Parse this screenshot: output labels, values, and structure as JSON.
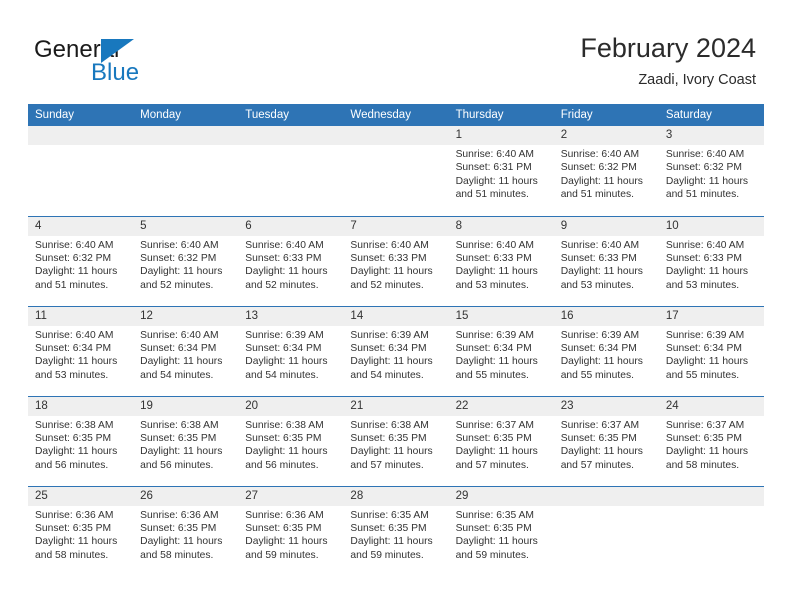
{
  "logo": {
    "word1": "General",
    "word2": "Blue",
    "accent_color": "#1878be",
    "triangle_icon": "triangle-icon"
  },
  "header": {
    "title": "February 2024",
    "subtitle": "Zaadi, Ivory Coast"
  },
  "theme": {
    "header_blue": "#2e74b5",
    "daynum_band": "#efefef",
    "text": "#333333"
  },
  "calendar": {
    "columns": [
      "Sunday",
      "Monday",
      "Tuesday",
      "Wednesday",
      "Thursday",
      "Friday",
      "Saturday"
    ],
    "weeks": [
      [
        {
          "day": ""
        },
        {
          "day": ""
        },
        {
          "day": ""
        },
        {
          "day": ""
        },
        {
          "day": "1",
          "sunrise": "Sunrise: 6:40 AM",
          "sunset": "Sunset: 6:31 PM",
          "daylight_line1": "Daylight: 11 hours",
          "daylight_line2": "and 51 minutes."
        },
        {
          "day": "2",
          "sunrise": "Sunrise: 6:40 AM",
          "sunset": "Sunset: 6:32 PM",
          "daylight_line1": "Daylight: 11 hours",
          "daylight_line2": "and 51 minutes."
        },
        {
          "day": "3",
          "sunrise": "Sunrise: 6:40 AM",
          "sunset": "Sunset: 6:32 PM",
          "daylight_line1": "Daylight: 11 hours",
          "daylight_line2": "and 51 minutes."
        }
      ],
      [
        {
          "day": "4",
          "sunrise": "Sunrise: 6:40 AM",
          "sunset": "Sunset: 6:32 PM",
          "daylight_line1": "Daylight: 11 hours",
          "daylight_line2": "and 51 minutes."
        },
        {
          "day": "5",
          "sunrise": "Sunrise: 6:40 AM",
          "sunset": "Sunset: 6:32 PM",
          "daylight_line1": "Daylight: 11 hours",
          "daylight_line2": "and 52 minutes."
        },
        {
          "day": "6",
          "sunrise": "Sunrise: 6:40 AM",
          "sunset": "Sunset: 6:33 PM",
          "daylight_line1": "Daylight: 11 hours",
          "daylight_line2": "and 52 minutes."
        },
        {
          "day": "7",
          "sunrise": "Sunrise: 6:40 AM",
          "sunset": "Sunset: 6:33 PM",
          "daylight_line1": "Daylight: 11 hours",
          "daylight_line2": "and 52 minutes."
        },
        {
          "day": "8",
          "sunrise": "Sunrise: 6:40 AM",
          "sunset": "Sunset: 6:33 PM",
          "daylight_line1": "Daylight: 11 hours",
          "daylight_line2": "and 53 minutes."
        },
        {
          "day": "9",
          "sunrise": "Sunrise: 6:40 AM",
          "sunset": "Sunset: 6:33 PM",
          "daylight_line1": "Daylight: 11 hours",
          "daylight_line2": "and 53 minutes."
        },
        {
          "day": "10",
          "sunrise": "Sunrise: 6:40 AM",
          "sunset": "Sunset: 6:33 PM",
          "daylight_line1": "Daylight: 11 hours",
          "daylight_line2": "and 53 minutes."
        }
      ],
      [
        {
          "day": "11",
          "sunrise": "Sunrise: 6:40 AM",
          "sunset": "Sunset: 6:34 PM",
          "daylight_line1": "Daylight: 11 hours",
          "daylight_line2": "and 53 minutes."
        },
        {
          "day": "12",
          "sunrise": "Sunrise: 6:40 AM",
          "sunset": "Sunset: 6:34 PM",
          "daylight_line1": "Daylight: 11 hours",
          "daylight_line2": "and 54 minutes."
        },
        {
          "day": "13",
          "sunrise": "Sunrise: 6:39 AM",
          "sunset": "Sunset: 6:34 PM",
          "daylight_line1": "Daylight: 11 hours",
          "daylight_line2": "and 54 minutes."
        },
        {
          "day": "14",
          "sunrise": "Sunrise: 6:39 AM",
          "sunset": "Sunset: 6:34 PM",
          "daylight_line1": "Daylight: 11 hours",
          "daylight_line2": "and 54 minutes."
        },
        {
          "day": "15",
          "sunrise": "Sunrise: 6:39 AM",
          "sunset": "Sunset: 6:34 PM",
          "daylight_line1": "Daylight: 11 hours",
          "daylight_line2": "and 55 minutes."
        },
        {
          "day": "16",
          "sunrise": "Sunrise: 6:39 AM",
          "sunset": "Sunset: 6:34 PM",
          "daylight_line1": "Daylight: 11 hours",
          "daylight_line2": "and 55 minutes."
        },
        {
          "day": "17",
          "sunrise": "Sunrise: 6:39 AM",
          "sunset": "Sunset: 6:34 PM",
          "daylight_line1": "Daylight: 11 hours",
          "daylight_line2": "and 55 minutes."
        }
      ],
      [
        {
          "day": "18",
          "sunrise": "Sunrise: 6:38 AM",
          "sunset": "Sunset: 6:35 PM",
          "daylight_line1": "Daylight: 11 hours",
          "daylight_line2": "and 56 minutes."
        },
        {
          "day": "19",
          "sunrise": "Sunrise: 6:38 AM",
          "sunset": "Sunset: 6:35 PM",
          "daylight_line1": "Daylight: 11 hours",
          "daylight_line2": "and 56 minutes."
        },
        {
          "day": "20",
          "sunrise": "Sunrise: 6:38 AM",
          "sunset": "Sunset: 6:35 PM",
          "daylight_line1": "Daylight: 11 hours",
          "daylight_line2": "and 56 minutes."
        },
        {
          "day": "21",
          "sunrise": "Sunrise: 6:38 AM",
          "sunset": "Sunset: 6:35 PM",
          "daylight_line1": "Daylight: 11 hours",
          "daylight_line2": "and 57 minutes."
        },
        {
          "day": "22",
          "sunrise": "Sunrise: 6:37 AM",
          "sunset": "Sunset: 6:35 PM",
          "daylight_line1": "Daylight: 11 hours",
          "daylight_line2": "and 57 minutes."
        },
        {
          "day": "23",
          "sunrise": "Sunrise: 6:37 AM",
          "sunset": "Sunset: 6:35 PM",
          "daylight_line1": "Daylight: 11 hours",
          "daylight_line2": "and 57 minutes."
        },
        {
          "day": "24",
          "sunrise": "Sunrise: 6:37 AM",
          "sunset": "Sunset: 6:35 PM",
          "daylight_line1": "Daylight: 11 hours",
          "daylight_line2": "and 58 minutes."
        }
      ],
      [
        {
          "day": "25",
          "sunrise": "Sunrise: 6:36 AM",
          "sunset": "Sunset: 6:35 PM",
          "daylight_line1": "Daylight: 11 hours",
          "daylight_line2": "and 58 minutes."
        },
        {
          "day": "26",
          "sunrise": "Sunrise: 6:36 AM",
          "sunset": "Sunset: 6:35 PM",
          "daylight_line1": "Daylight: 11 hours",
          "daylight_line2": "and 58 minutes."
        },
        {
          "day": "27",
          "sunrise": "Sunrise: 6:36 AM",
          "sunset": "Sunset: 6:35 PM",
          "daylight_line1": "Daylight: 11 hours",
          "daylight_line2": "and 59 minutes."
        },
        {
          "day": "28",
          "sunrise": "Sunrise: 6:35 AM",
          "sunset": "Sunset: 6:35 PM",
          "daylight_line1": "Daylight: 11 hours",
          "daylight_line2": "and 59 minutes."
        },
        {
          "day": "29",
          "sunrise": "Sunrise: 6:35 AM",
          "sunset": "Sunset: 6:35 PM",
          "daylight_line1": "Daylight: 11 hours",
          "daylight_line2": "and 59 minutes."
        },
        {
          "day": ""
        },
        {
          "day": ""
        }
      ]
    ]
  }
}
